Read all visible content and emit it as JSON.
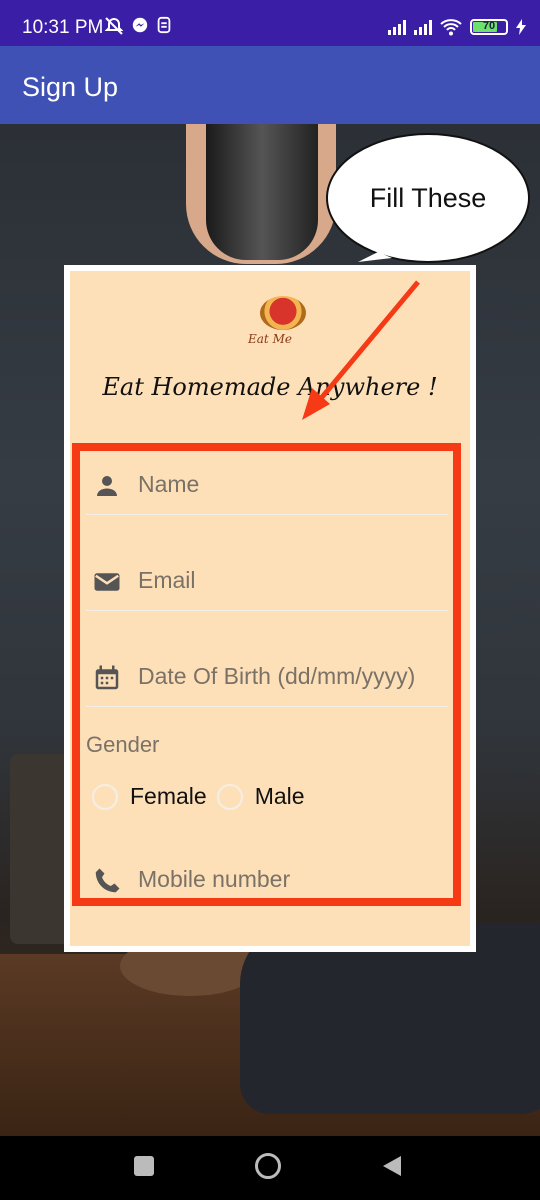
{
  "status_bar": {
    "time": "10:31 PM",
    "battery": "70",
    "icons": [
      "mute-icon",
      "messenger-icon",
      "sync-icon",
      "signal-icon",
      "wifi-icon",
      "battery-icon",
      "charging-icon"
    ]
  },
  "app_bar": {
    "title": "Sign Up"
  },
  "card": {
    "brand": "Eat Me",
    "tagline": "Eat Homemade Anywhere !"
  },
  "callout": {
    "text": "Fill These"
  },
  "form": {
    "name_placeholder": "Name",
    "email_placeholder": "Email",
    "dob_placeholder": "Date Of Birth (dd/mm/yyyy)",
    "gender_label": "Gender",
    "gender_options": [
      "Female",
      "Male"
    ],
    "mobile_placeholder": "Mobile number"
  },
  "colors": {
    "status_bar": "#3a1fa6",
    "app_bar": "#3f51b5",
    "card_bg": "#fee0b8",
    "highlight_box": "#f63a16"
  }
}
